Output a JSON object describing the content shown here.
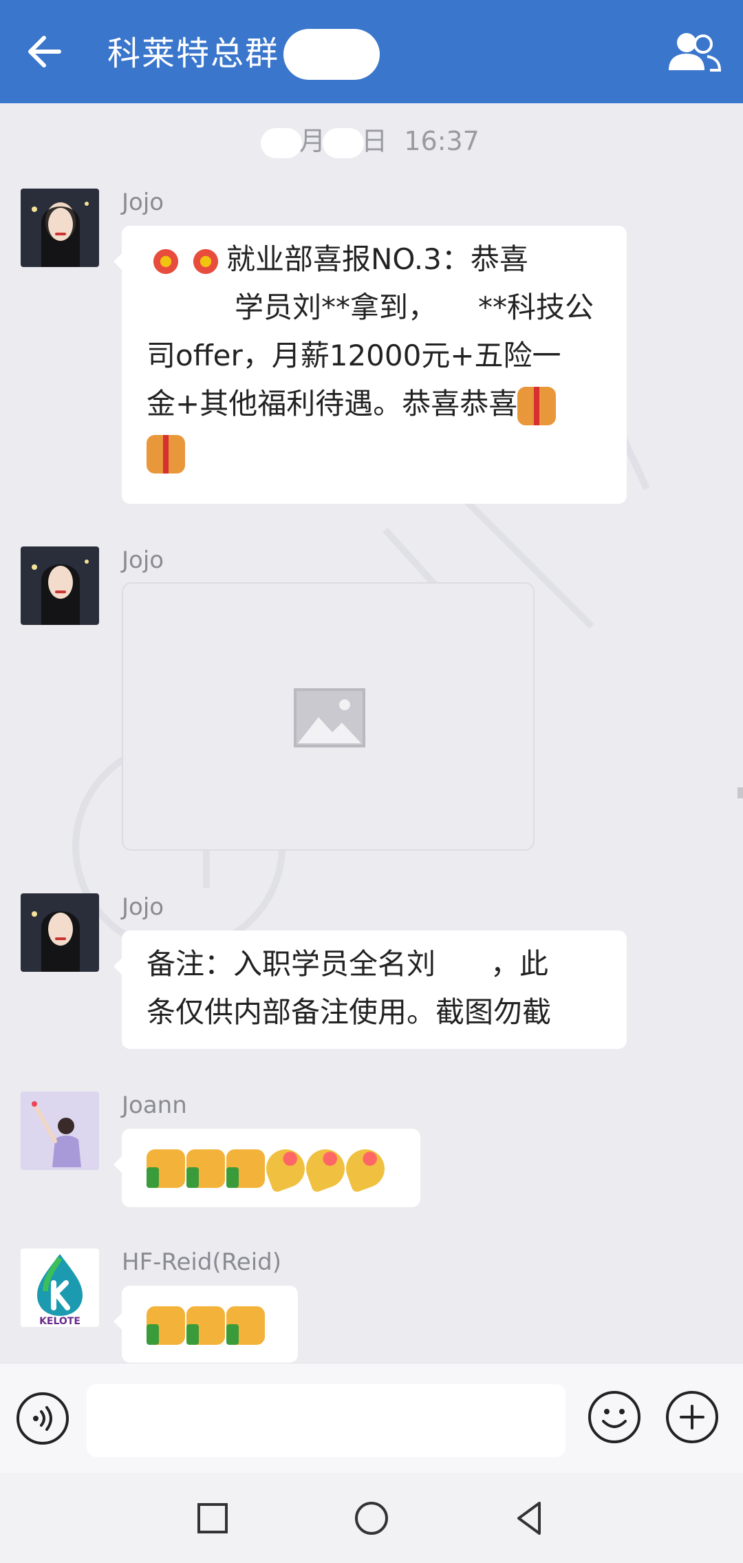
{
  "header": {
    "title": "科莱特总群",
    "back_icon": "arrow-left-icon",
    "members_icon": "group-members-icon",
    "background_color": "#3a76cc"
  },
  "timestamp": {
    "month_suffix": "月",
    "day_suffix": "日",
    "time": "16:37"
  },
  "messages": [
    {
      "sender": "Jojo",
      "type": "text",
      "lines": [
        "就业部喜报NO.3：恭喜",
        "学员刘**拿到，",
        "**科技公",
        "司offer，月薪12000元+五险一",
        "金+其他福利待遇。恭喜恭喜"
      ],
      "emojis": [
        "firework",
        "firework",
        "gift",
        "gift"
      ]
    },
    {
      "sender": "Jojo",
      "type": "image",
      "image_icon": "image-placeholder-icon"
    },
    {
      "sender": "Jojo",
      "type": "text",
      "lines": [
        "备注：入职学员全名刘",
        "，此",
        "条仅供内部备注使用。截图勿截"
      ]
    },
    {
      "sender": "Joann",
      "type": "emoji",
      "emojis": [
        "thumbs-up",
        "thumbs-up",
        "thumbs-up",
        "party-popper",
        "party-popper",
        "party-popper"
      ]
    },
    {
      "sender": "HF-Reid(Reid)",
      "type": "emoji",
      "emojis": [
        "thumbs-up",
        "thumbs-up",
        "thumbs-up"
      ],
      "avatar_logo_text": "KELOTE"
    }
  ],
  "input": {
    "placeholder": "",
    "voice_icon": "voice-icon",
    "emoji_icon": "smiley-icon",
    "plus_icon": "plus-circle-icon"
  },
  "navbar": {
    "recent_icon": "square-icon",
    "home_icon": "circle-icon",
    "back_icon": "triangle-back-icon"
  }
}
